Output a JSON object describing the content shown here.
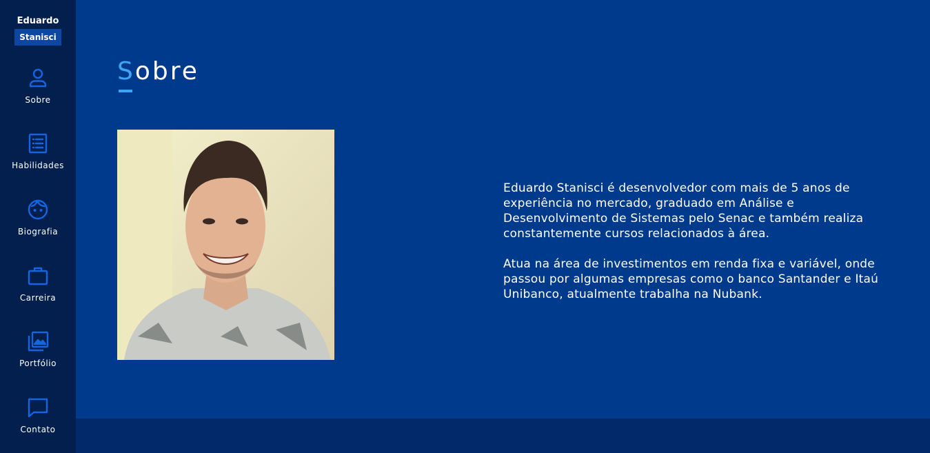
{
  "brand": {
    "first_name": "Eduardo",
    "last_name": "Stanisci"
  },
  "sidebar": {
    "items": [
      {
        "label": "Sobre",
        "icon": "user-icon"
      },
      {
        "label": "Habilidades",
        "icon": "list-icon"
      },
      {
        "label": "Biografia",
        "icon": "face-icon"
      },
      {
        "label": "Carreira",
        "icon": "briefcase-icon"
      },
      {
        "label": "Portfólio",
        "icon": "photo-library-icon"
      },
      {
        "label": "Contato",
        "icon": "chat-icon"
      }
    ]
  },
  "main": {
    "title_first_letter": "S",
    "title_rest": "obre",
    "photo": "profile-photo",
    "paragraphs": [
      "Eduardo Stanisci é desenvolvedor com mais de 5 anos de experiência no mercado, graduado em Análise e Desenvolvimento de Sistemas pelo Senac e também realiza constantemente cursos relacionados à área.",
      "Atua na área de investimentos em renda fixa e variável, onde passou por algumas empresas como o banco Santander e Itaú Unibanco, atualmente trabalha na Nubank."
    ]
  },
  "colors": {
    "background": "#003a8c",
    "sidebar": "#021f4d",
    "footer": "#022a6b",
    "accent": "#3da5f5",
    "icon": "#1565e0"
  }
}
